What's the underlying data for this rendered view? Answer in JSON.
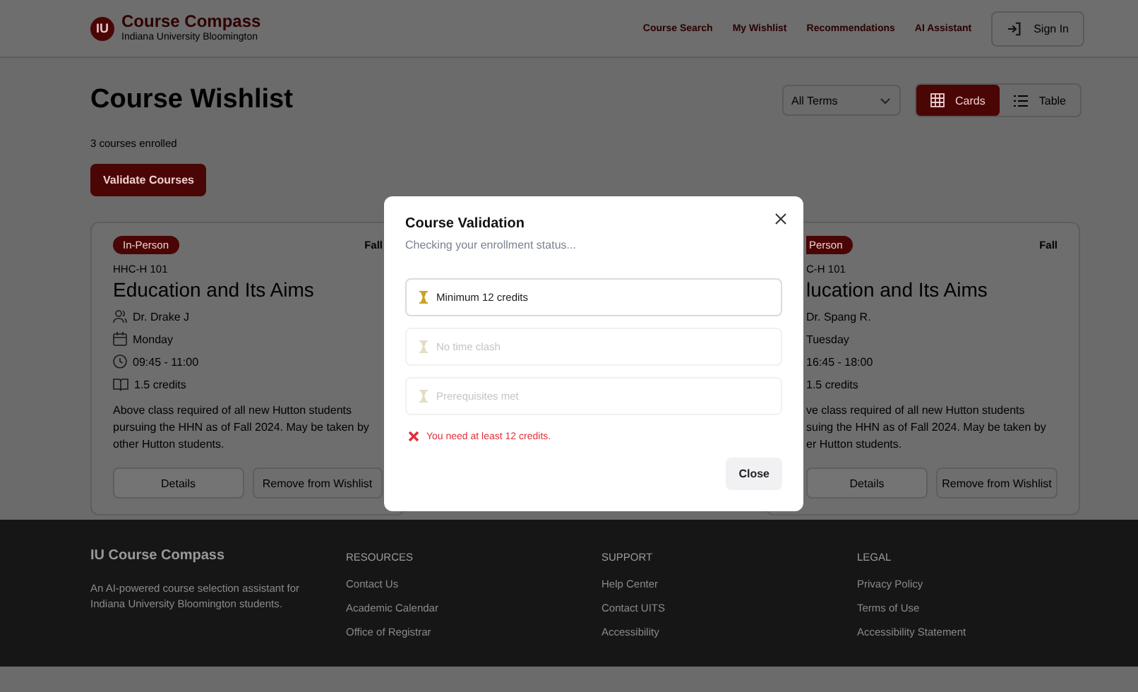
{
  "header": {
    "logo_mark": "IU",
    "brand_title": "Course Compass",
    "brand_subtitle": "Indiana University Bloomington",
    "nav": [
      {
        "label": "Course Search"
      },
      {
        "label": "My Wishlist"
      },
      {
        "label": "Recommendations"
      },
      {
        "label": "AI Assistant"
      }
    ],
    "sign_in": "Sign In"
  },
  "page": {
    "title": "Course Wishlist",
    "term_select": "All Terms",
    "view_toggle": [
      {
        "label": "Cards",
        "kind": "grid",
        "selected": true
      },
      {
        "label": "Table",
        "kind": "list",
        "selected": false
      }
    ],
    "enrolled_count": "3 courses enrolled",
    "validate_button": "Validate Courses"
  },
  "cards": [
    {
      "covered": false,
      "format": "In-Person",
      "term": "Fall",
      "code": "HHC-H 101",
      "title": "Education and Its Aims",
      "instructor": "Dr. Drake J",
      "day": "Monday",
      "time": "09:45 - 11:00",
      "credits": "1.5 credits",
      "description_lines": [
        "Above class required of all new Hutton students",
        "pursuing the HHN as of Fall 2024. May be taken by",
        "other Hutton students."
      ],
      "buttons": [
        "Details",
        "Remove from Wishlist"
      ]
    },
    {
      "covered": true,
      "format": "Person",
      "term": "Fall",
      "code": "C-H 101",
      "title": "lucation and Its Aims",
      "instructor": "Dr. Spang R.",
      "day": "Tuesday",
      "time": "16:45 - 18:00",
      "credits": "1.5 credits",
      "description_lines": [
        "ve class required of all new Hutton students",
        "suing the HHN as of Fall 2024. May be taken by",
        "er Hutton students."
      ],
      "buttons": [
        "Details",
        "Remove from Wishlist"
      ]
    }
  ],
  "modal": {
    "title": "Course Validation",
    "subtitle": "Checking your enrollment status...",
    "checks": [
      {
        "label": "Minimum 12 credits",
        "active": true
      },
      {
        "label": "No time clash",
        "active": false
      },
      {
        "label": "Prerequisites met",
        "active": false
      }
    ],
    "error": "You need at least 12 credits.",
    "close_button": "Close"
  },
  "footer": {
    "brand": "IU Course Compass",
    "description": "An AI-powered course selection assistant for Indiana University Bloomington students.",
    "columns": [
      {
        "heading": "RESOURCES",
        "links": [
          "Contact Us",
          "Academic Calendar",
          "Office of Registrar"
        ]
      },
      {
        "heading": "SUPPORT",
        "links": [
          "Help Center",
          "Contact UITS",
          "Accessibility"
        ]
      },
      {
        "heading": "LEGAL",
        "links": [
          "Privacy Policy",
          "Terms of Use",
          "Accessibility Statement"
        ]
      }
    ]
  }
}
